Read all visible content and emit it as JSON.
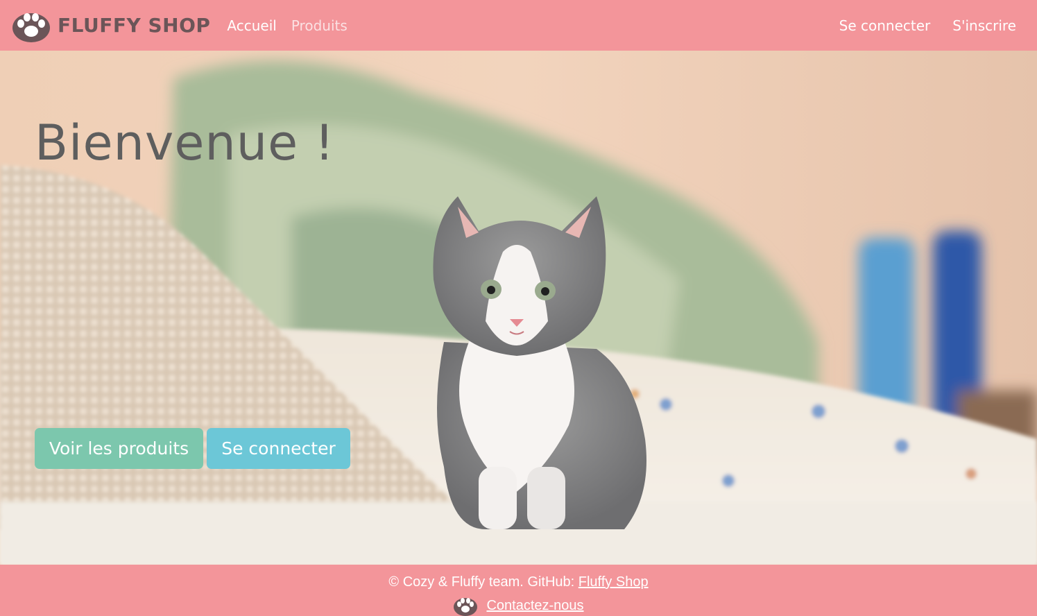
{
  "navbar": {
    "brand": "FLUFFY SHOP",
    "brand_icon": "paw-icon",
    "links": {
      "home": "Accueil",
      "products": "Produits"
    },
    "auth": {
      "login": "Se connecter",
      "register": "S'inscrire"
    }
  },
  "hero": {
    "title": "Bienvenue !",
    "image": "kitten-photo",
    "buttons": {
      "products": "Voir les produits",
      "login": "Se connecter"
    }
  },
  "footer": {
    "copyright": "© Cozy & Fluffy team. GitHub: ",
    "github_link": "Fluffy Shop",
    "contact_icon": "paw-icon",
    "contact_link": "Contactez-nous"
  },
  "colors": {
    "primary": "#f3959a",
    "brand_text": "#6b5558",
    "btn_products": "#7cc7ad",
    "btn_login": "#6cc7d7",
    "title": "#5e5e5e"
  }
}
